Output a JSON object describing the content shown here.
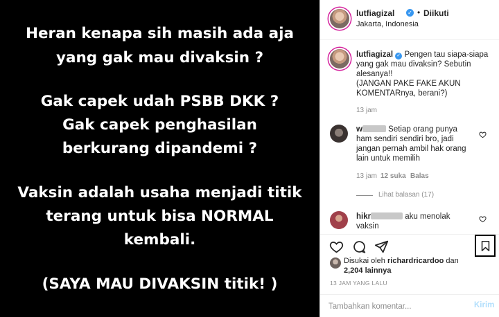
{
  "post_image": {
    "lines": [
      "Heran kenapa sih masih ada aja",
      "yang gak mau divaksin ?",
      "Gak capek udah PSBB DKK ?",
      "Gak capek penghasilan",
      "berkurang dipandemi ?",
      "Vaksin adalah usaha menjadi titik",
      "terang untuk bisa NORMAL",
      "kembali.",
      "(SAYA MAU DIVAKSIN titik! )"
    ]
  },
  "header": {
    "username": "lutfiagizal",
    "follow_label": "Diikuti",
    "location": "Jakarta, Indonesia"
  },
  "caption": {
    "username": "lutfiagizal",
    "lines": [
      "Pengen tau siapa-siapa",
      "yang gak mau divaksin? Sebutin",
      "alesanya!!",
      "(JANGAN PAKE FAKE AKUN",
      "KOMENTARnya, berani?)"
    ],
    "time": "13 jam"
  },
  "comments": [
    {
      "user_prefix": "w",
      "lines": [
        "Setiap orang punya",
        "ham sendiri sendiri bro, jadi",
        "jangan pernah ambil hak orang",
        "lain untuk memilih"
      ],
      "time": "13 jam",
      "likes": "12 suka",
      "reply": "Balas",
      "view_replies": "Lihat balasan (17)"
    },
    {
      "user_prefix": "hikr",
      "lines": [
        "aku menolak",
        "vaksin"
      ]
    }
  ],
  "likes": {
    "prefix": "Disukai oleh",
    "user": "richardricardoo",
    "and": "dan",
    "others": "2,204 lainnya"
  },
  "date": "13 JAM YANG LALU",
  "add_comment": {
    "placeholder": "Tambahkan komentar...",
    "post_label": "Kirim"
  },
  "colors": {
    "verified": "#3897f0",
    "post_button": "#b2dffc",
    "muted": "#8e8e8e"
  }
}
